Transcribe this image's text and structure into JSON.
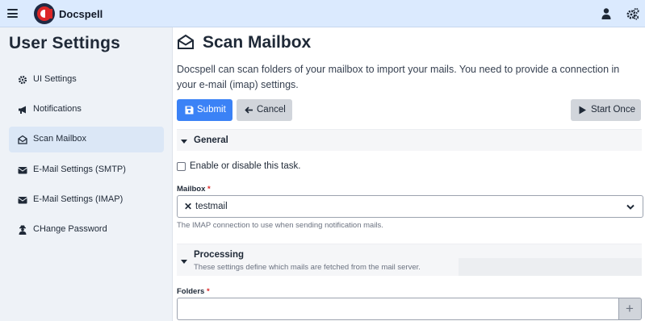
{
  "header": {
    "app_name": "Docspell",
    "icons": [
      "hamburger-menu-icon",
      "docspell-logo",
      "user-icon",
      "settings-cogs-icon"
    ]
  },
  "sidebar": {
    "title": "User Settings",
    "items": [
      {
        "label": "UI Settings",
        "icon": "cog-icon",
        "active": false
      },
      {
        "label": "Notifications",
        "icon": "bullhorn-icon",
        "active": false
      },
      {
        "label": "Scan Mailbox",
        "icon": "envelope-open-icon",
        "active": true
      },
      {
        "label": "E-Mail Settings (SMTP)",
        "icon": "envelope-icon",
        "active": false
      },
      {
        "label": "E-Mail Settings (IMAP)",
        "icon": "envelope-icon",
        "active": false
      },
      {
        "label": "CHange Password",
        "icon": "user-secret-icon",
        "active": false
      }
    ]
  },
  "main": {
    "title": "Scan Mailbox",
    "intro": "Docspell can scan folders of your mailbox to import your mails. You need to provide a connection in your e-mail (imap) settings.",
    "buttons": {
      "submit": "Submit",
      "cancel": "Cancel",
      "start_once": "Start Once"
    },
    "general": {
      "title": "General",
      "enable_label": "Enable or disable this task.",
      "enabled": false,
      "mailbox_label": "Mailbox",
      "required_mark": "*",
      "mailbox_value": "testmail",
      "mailbox_help": "The IMAP connection to use when sending notification mails."
    },
    "processing": {
      "title": "Processing",
      "subtitle": "These settings define which mails are fetched from the mail server.",
      "folders_label": "Folders",
      "required_mark": "*",
      "folders_value": "",
      "add_symbol": "+"
    }
  },
  "colors": {
    "topbar": "#dbeafe",
    "sidebar": "#eef2f7",
    "primary": "#3b82f6",
    "secondary": "#d1d5db",
    "required": "#dc2626"
  }
}
